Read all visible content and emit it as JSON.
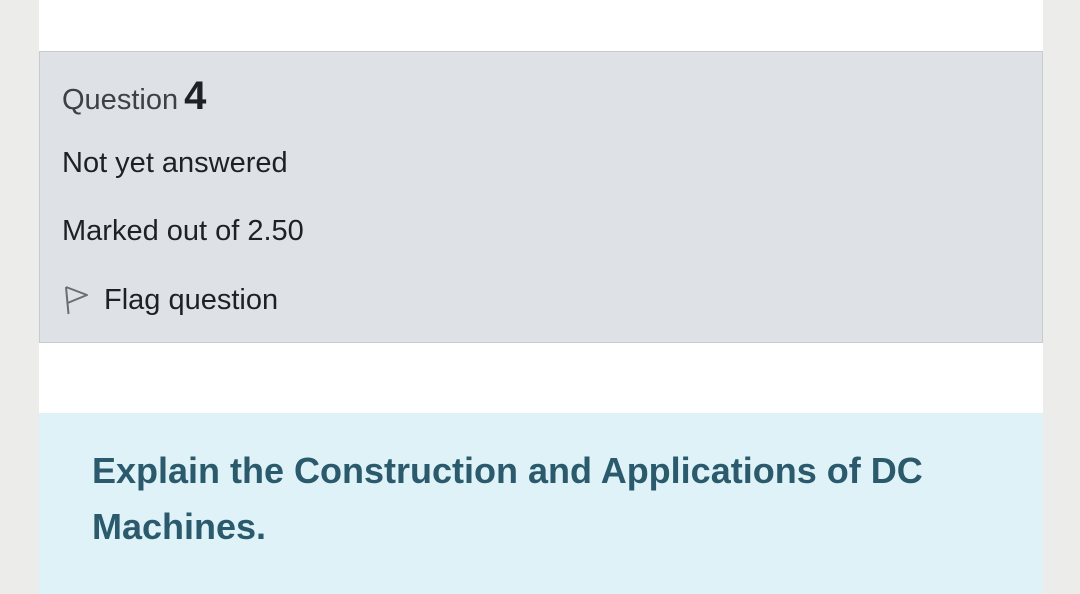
{
  "question_info": {
    "label": "Question",
    "number": "4",
    "state": "Not yet answered",
    "grade": "Marked out of 2.50",
    "flag_label": "Flag question"
  },
  "question": {
    "text": "Explain the Construction and Applications of DC Machines."
  },
  "icons": {
    "flag": "flag-outline-icon"
  },
  "colors": {
    "info_bg": "#dee2e6",
    "question_bg": "#def2f8",
    "question_text": "#2a5a6b"
  }
}
